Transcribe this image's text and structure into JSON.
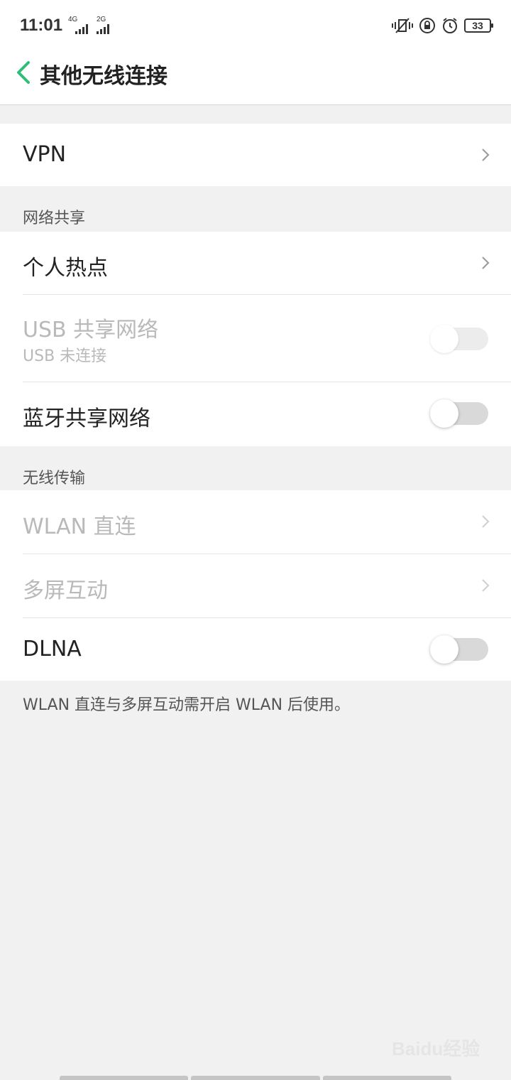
{
  "status_bar": {
    "time": "11:01",
    "network_1": "4G",
    "network_2": "2G",
    "battery": "33"
  },
  "header": {
    "title": "其他无线连接"
  },
  "vpn": {
    "label": "VPN"
  },
  "tethering": {
    "section_title": "网络共享",
    "hotspot_label": "个人热点",
    "usb_label": "USB 共享网络",
    "usb_status": "USB 未连接",
    "bluetooth_label": "蓝牙共享网络"
  },
  "wireless": {
    "section_title": "无线传输",
    "wlan_direct_label": "WLAN 直连",
    "multiscreen_label": "多屏互动",
    "dlna_label": "DLNA"
  },
  "footer_note": "WLAN 直连与多屏互动需开启 WLAN 后使用。",
  "watermark": "Baidu经验",
  "colors": {
    "accent": "#2dbf77",
    "disabled_text": "#b9b9b9",
    "background": "#f1f1f1"
  }
}
